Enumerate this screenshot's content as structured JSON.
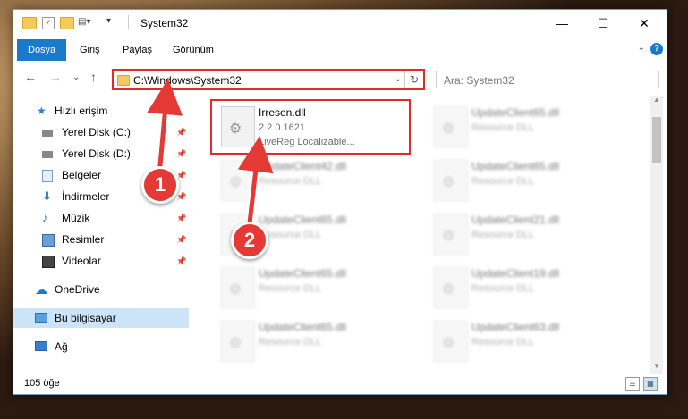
{
  "window": {
    "title": "System32",
    "buttons": {
      "minimize": "—",
      "maximize": "☐",
      "close": "✕"
    }
  },
  "ribbon": {
    "tabs": [
      "Dosya",
      "Giriş",
      "Paylaş",
      "Görünüm"
    ],
    "collapse": "⌄",
    "help": "?"
  },
  "nav": {
    "back": "←",
    "forward": "→",
    "recent": "⌄",
    "up": "↑",
    "address_path": "C:\\Windows\\System32",
    "address_dropdown": "⌄",
    "refresh": "↻",
    "search_placeholder": "Ara: System32"
  },
  "sidebar": {
    "items": [
      {
        "label": "Hızlı erişim",
        "icon": "star-icon",
        "pinned": false
      },
      {
        "label": "Yerel Disk (C:)",
        "icon": "drive-icon",
        "pinned": true
      },
      {
        "label": "Yerel Disk (D:)",
        "icon": "drive-icon",
        "pinned": true
      },
      {
        "label": "Belgeler",
        "icon": "documents-icon",
        "pinned": true
      },
      {
        "label": "İndirmeler",
        "icon": "download-icon",
        "pinned": true
      },
      {
        "label": "Müzik",
        "icon": "music-icon",
        "pinned": true
      },
      {
        "label": "Resimler",
        "icon": "pictures-icon",
        "pinned": true
      },
      {
        "label": "Videolar",
        "icon": "video-icon",
        "pinned": true
      },
      {
        "label": "OneDrive",
        "icon": "cloud-icon",
        "pinned": false
      },
      {
        "label": "Bu bilgisayar",
        "icon": "computer-icon",
        "pinned": false,
        "selected": true
      },
      {
        "label": "Ağ",
        "icon": "network-icon",
        "pinned": false
      }
    ],
    "pin_glyph": "📌"
  },
  "files": [
    {
      "name": "Irresen.dll",
      "line1": "2.2.0.1621",
      "line2": "LiveReg Localizable...",
      "highlight": true
    },
    {
      "name": "UpdateClient65.dll",
      "line1": "Resource DLL"
    },
    {
      "name": "UpdateClient42.dll",
      "line1": "Resource DLL"
    },
    {
      "name": "UpdateClient65.dll",
      "line1": "Resource DLL"
    },
    {
      "name": "UpdateClient65.dll",
      "line1": "Resource DLL"
    },
    {
      "name": "UpdateClient21.dll",
      "line1": "Resource DLL"
    },
    {
      "name": "UpdateClient65.dll",
      "line1": "Resource DLL"
    },
    {
      "name": "UpdateClient19.dll",
      "line1": "Resource DLL"
    },
    {
      "name": "UpdateClient65.dll",
      "line1": "Resource DLL"
    },
    {
      "name": "UpdateClient63.dll",
      "line1": "Resource DLL"
    }
  ],
  "status": {
    "count": "105 öğe"
  },
  "annotations": {
    "badge1": "1",
    "badge2": "2"
  },
  "colors": {
    "accent": "#1979ca",
    "highlight": "#e12b2b",
    "badge": "#e53935"
  }
}
